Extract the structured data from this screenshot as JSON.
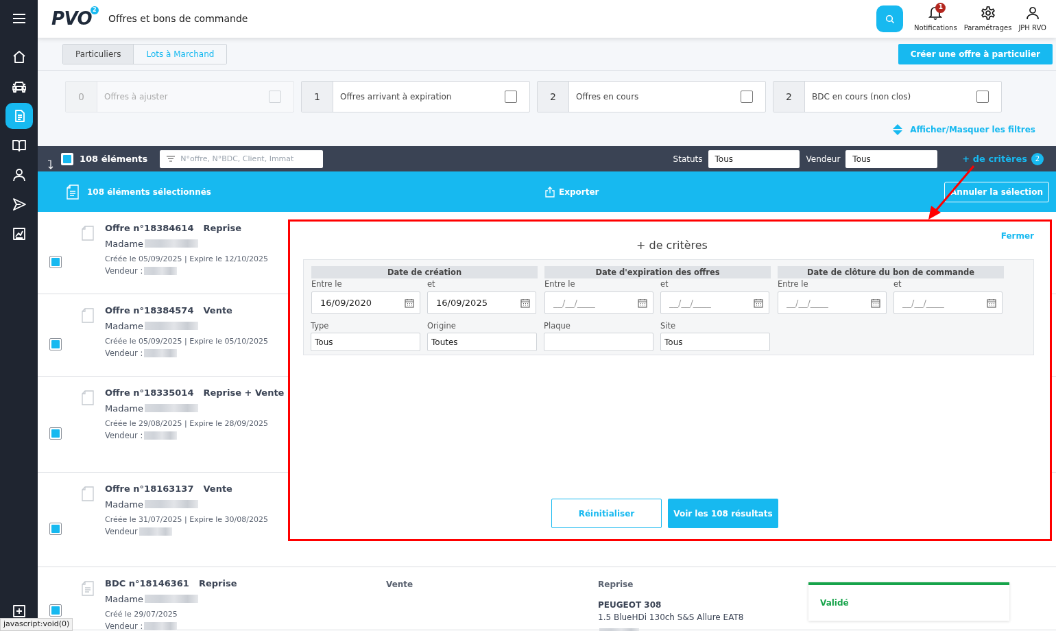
{
  "sidebar": {
    "items": [
      {
        "kind": "menu",
        "selected": false
      },
      {
        "kind": "home",
        "selected": false
      },
      {
        "kind": "car",
        "selected": false
      },
      {
        "kind": "document",
        "selected": true
      },
      {
        "kind": "book",
        "selected": false
      },
      {
        "kind": "user",
        "selected": false
      },
      {
        "kind": "send",
        "selected": false
      },
      {
        "kind": "chart",
        "selected": false
      },
      {
        "kind": "add",
        "selected": false
      }
    ]
  },
  "header": {
    "logo": "PVO",
    "logo_badge": "2",
    "title": "Offres et bons de commande",
    "nav": [
      {
        "kind": "bell",
        "label": "Notifications",
        "badge": "1"
      },
      {
        "kind": "gear",
        "label": "Paramétrages"
      },
      {
        "kind": "user",
        "label": "JPH RVO"
      }
    ]
  },
  "tabs": [
    {
      "label": "Particuliers",
      "selected": true
    },
    {
      "label": "Lots à Marchand",
      "selected": false
    }
  ],
  "create_button": "Créer une offre à particulier",
  "filter_cards": [
    {
      "count": "0",
      "label": "Offres à ajuster",
      "disabled": true,
      "checked": false
    },
    {
      "count": "1",
      "label": "Offres arrivant à expiration",
      "disabled": false,
      "checked": false
    },
    {
      "count": "2",
      "label": "Offres en cours",
      "disabled": false,
      "checked": false
    },
    {
      "count": "2",
      "label": "BDC en cours (non clos)",
      "disabled": false,
      "checked": false
    }
  ],
  "toggle_filters": "Afficher/Masquer les filtres",
  "toolbar": {
    "select_all_checked": true,
    "count": "108 éléments",
    "search_placeholder": "N°offre, N°BDC, Client, Immat",
    "statuts_label": "Statuts",
    "statuts_value": "Tous",
    "vendeur_label": "Vendeur",
    "vendeur_value": "Tous",
    "more_link": "+ de critères",
    "more_badge": "2"
  },
  "selection_bar": {
    "text": "108 éléments sélectionnés",
    "export": "Exporter",
    "cancel": "Annuler la sélection"
  },
  "rows": [
    {
      "checked": true,
      "kind": "offer",
      "title": "Offre n°18384614",
      "type": "Reprise",
      "client": "Madame",
      "dates": "Créée le 05/09/2025 | Expire le 12/10/2025",
      "seller": "Vendeur :"
    },
    {
      "checked": true,
      "kind": "offer",
      "title": "Offre n°18384574",
      "type": "Vente",
      "client": "Madame",
      "dates": "Créée le 05/09/2025 | Expire le 05/10/2025",
      "seller": "Vendeur :"
    },
    {
      "checked": true,
      "kind": "offer",
      "title": "Offre n°18335014",
      "type": "Reprise + Vente",
      "client": "Madame",
      "dates": "Créée le 29/08/2025 | Expire le 28/09/2025",
      "seller": "Vendeur :"
    },
    {
      "checked": true,
      "kind": "offer",
      "title": "Offre n°18163137",
      "type": "Vente",
      "client": "Madame",
      "dates": "Créée le 31/07/2025 | Expire le 30/08/2025",
      "seller": "Vendeur"
    },
    {
      "checked": true,
      "kind": "order",
      "title": "BDC n°18146361",
      "type": "Reprise",
      "client": "Madame",
      "dates": "Créé le 29/07/2025",
      "seller": "Vendeur :",
      "column_2": "Vente",
      "column_3_heading": "Reprise",
      "vehicle": "PEUGEOT 308",
      "vehicle_detail": "1.5 BlueHDi 130ch S&S Allure EAT8",
      "status": "Validé"
    }
  ],
  "criteria_panel": {
    "title": "+ de critères",
    "close": "Fermer",
    "date_groups": [
      {
        "heading": "Date de création",
        "from_label": "Entre le",
        "from_value": "16/09/2020",
        "to_label": "et",
        "to_value": "16/09/2025"
      },
      {
        "heading": "Date d'expiration des offres",
        "from_label": "Entre le",
        "from_placeholder": "__/__/____",
        "to_label": "et",
        "to_placeholder": "__/__/____"
      },
      {
        "heading": "Date de clôture du bon de commande",
        "from_label": "Entre le",
        "from_placeholder": "__/__/____",
        "to_label": "et",
        "to_placeholder": "__/__/____"
      }
    ],
    "fields": [
      {
        "label": "Type",
        "value": "Tous"
      },
      {
        "label": "Origine",
        "value": "Toutes"
      },
      {
        "label": "Plaque"
      },
      {
        "label": "Site",
        "value": "Tous"
      }
    ],
    "reset_button": "Réinitialiser",
    "submit_button": "Voir les 108 résultats"
  },
  "status_tooltip": "javascript:void(0)"
}
